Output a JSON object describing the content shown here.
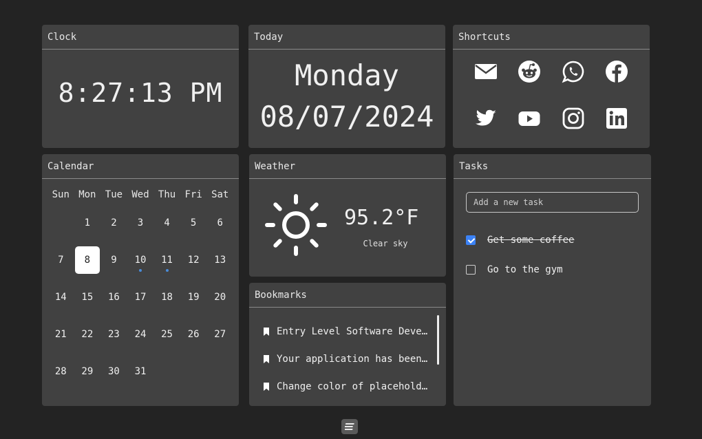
{
  "clock": {
    "title": "Clock",
    "time": "8:27:13 PM"
  },
  "today": {
    "title": "Today",
    "day": "Monday",
    "date": "08/07/2024"
  },
  "shortcuts": {
    "title": "Shortcuts",
    "items": [
      {
        "icon": "mail-icon"
      },
      {
        "icon": "reddit-icon"
      },
      {
        "icon": "whatsapp-icon"
      },
      {
        "icon": "facebook-icon"
      },
      {
        "icon": "twitter-icon"
      },
      {
        "icon": "youtube-icon"
      },
      {
        "icon": "instagram-icon"
      },
      {
        "icon": "linkedin-icon"
      }
    ]
  },
  "calendar": {
    "title": "Calendar",
    "weekdays": [
      "Sun",
      "Mon",
      "Tue",
      "Wed",
      "Thu",
      "Fri",
      "Sat"
    ],
    "lead_blanks": 1,
    "days": [
      "1",
      "2",
      "3",
      "4",
      "5",
      "6",
      "7",
      "8",
      "9",
      "10",
      "11",
      "12",
      "13",
      "14",
      "15",
      "16",
      "17",
      "18",
      "19",
      "20",
      "21",
      "22",
      "23",
      "24",
      "25",
      "26",
      "27",
      "28",
      "29",
      "30",
      "31"
    ],
    "today": "8",
    "event_days": [
      "10",
      "11"
    ],
    "event_color": "#4a8bd8"
  },
  "weather": {
    "title": "Weather",
    "temp": "95.2°F",
    "desc": "Clear sky",
    "icon": "sun-icon"
  },
  "bookmarks": {
    "title": "Bookmarks",
    "items": [
      {
        "label": "Entry Level Software Developer"
      },
      {
        "label": "Your application has been received"
      },
      {
        "label": "Change color of placeholder"
      }
    ]
  },
  "tasks": {
    "title": "Tasks",
    "input_placeholder": "Add a new task",
    "items": [
      {
        "label": "Get some coffee",
        "done": true
      },
      {
        "label": "Go to the gym",
        "done": false
      }
    ]
  },
  "colors": {
    "background": "#232323",
    "card": "#414141",
    "accent": "#3b82f6"
  }
}
